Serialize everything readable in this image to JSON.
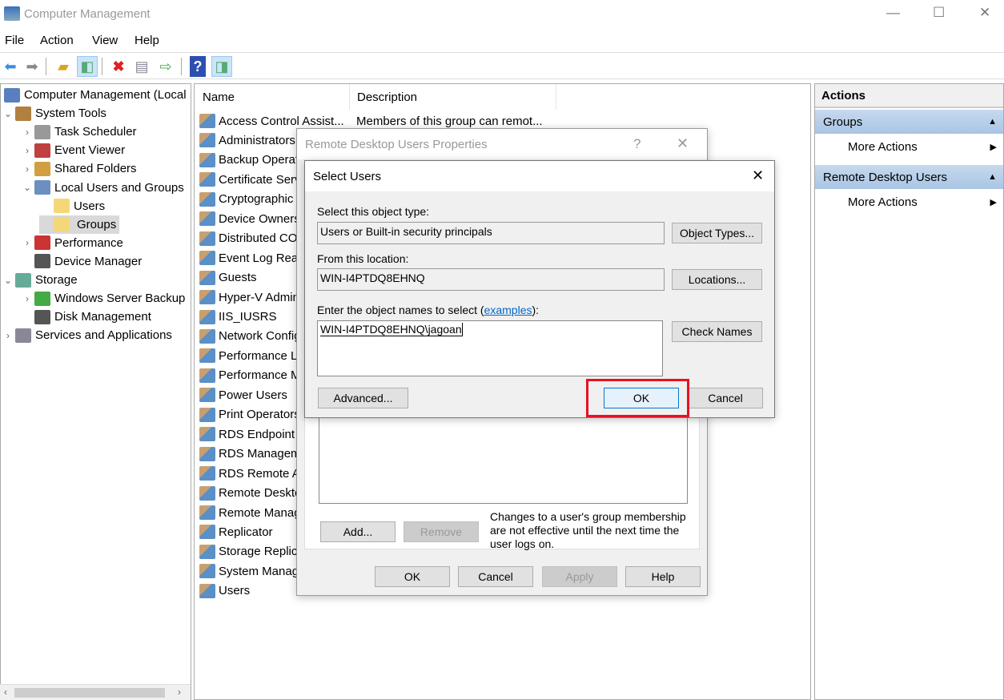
{
  "window": {
    "title": "Computer Management",
    "minimize": "—",
    "maximize": "☐",
    "close": "✕"
  },
  "menu": [
    "File",
    "Action",
    "View",
    "Help"
  ],
  "toolbar": [
    "back-icon",
    "forward-icon",
    "up-folder-icon",
    "show-hide-tree-icon",
    "delete-icon",
    "properties-icon",
    "export-list-icon",
    "help-icon",
    "show-hide-action-pane-icon"
  ],
  "tree": [
    {
      "label": "Computer Management (Local",
      "level": 0,
      "tw": ""
    },
    {
      "label": "System Tools",
      "level": 0,
      "tw": "⌄"
    },
    {
      "label": "Task Scheduler",
      "level": 1,
      "tw": "›"
    },
    {
      "label": "Event Viewer",
      "level": 1,
      "tw": "›"
    },
    {
      "label": "Shared Folders",
      "level": 1,
      "tw": "›"
    },
    {
      "label": "Local Users and Groups",
      "level": 1,
      "tw": "⌄"
    },
    {
      "label": "Users",
      "level": 2,
      "tw": ""
    },
    {
      "label": "Groups",
      "level": 2,
      "tw": "",
      "selected": true
    },
    {
      "label": "Performance",
      "level": 1,
      "tw": "›"
    },
    {
      "label": "Device Manager",
      "level": 1,
      "tw": ""
    },
    {
      "label": "Storage",
      "level": 0,
      "tw": "⌄"
    },
    {
      "label": "Windows Server Backup",
      "level": 1,
      "tw": "›"
    },
    {
      "label": "Disk Management",
      "level": 1,
      "tw": ""
    },
    {
      "label": "Services and Applications",
      "level": 0,
      "tw": "›"
    }
  ],
  "list": {
    "columns": [
      "Name",
      "Description"
    ],
    "rows": [
      {
        "name": "Access Control Assist...",
        "desc": "Members of this group can remot..."
      },
      {
        "name": "Administrators"
      },
      {
        "name": "Backup Operators"
      },
      {
        "name": "Certificate Service"
      },
      {
        "name": "Cryptographic"
      },
      {
        "name": "Device Owners"
      },
      {
        "name": "Distributed COM"
      },
      {
        "name": "Event Log Readers"
      },
      {
        "name": "Guests"
      },
      {
        "name": "Hyper-V Administrators"
      },
      {
        "name": "IIS_IUSRS"
      },
      {
        "name": "Network Configuration"
      },
      {
        "name": "Performance Log"
      },
      {
        "name": "Performance Monitor"
      },
      {
        "name": "Power Users"
      },
      {
        "name": "Print Operators"
      },
      {
        "name": "RDS Endpoint"
      },
      {
        "name": "RDS Management"
      },
      {
        "name": "RDS Remote Access"
      },
      {
        "name": "Remote Desktop Users"
      },
      {
        "name": "Remote Management"
      },
      {
        "name": "Replicator"
      },
      {
        "name": "Storage Replica"
      },
      {
        "name": "System Managed"
      },
      {
        "name": "Users"
      }
    ]
  },
  "actions": {
    "title": "Actions",
    "sections": [
      {
        "title": "Groups",
        "item": "More Actions"
      },
      {
        "title": "Remote Desktop Users",
        "item": "More Actions"
      }
    ]
  },
  "props": {
    "title": "Remote Desktop Users Properties",
    "help": "?",
    "close": "✕",
    "add": "Add...",
    "remove": "Remove",
    "note": "Changes to a user's group membership are not effective until the next time the user logs on.",
    "ok": "OK",
    "cancel": "Cancel",
    "apply": "Apply",
    "helpbtn": "Help"
  },
  "select": {
    "title": "Select Users",
    "close": "✕",
    "type_label": "Select this object type:",
    "type_value": "Users or Built-in security principals",
    "object_types": "Object Types...",
    "loc_label": "From this location:",
    "loc_value": "WIN-I4PTDQ8EHNQ",
    "locations": "Locations...",
    "names_label": "Enter the object names to select (",
    "examples": "examples",
    "names_label_end": "):",
    "names_value": "WIN-I4PTDQ8EHNQ\\jagoan",
    "check_names": "Check Names",
    "advanced": "Advanced...",
    "ok": "OK",
    "cancel": "Cancel"
  },
  "highlight_color": "#e81123"
}
